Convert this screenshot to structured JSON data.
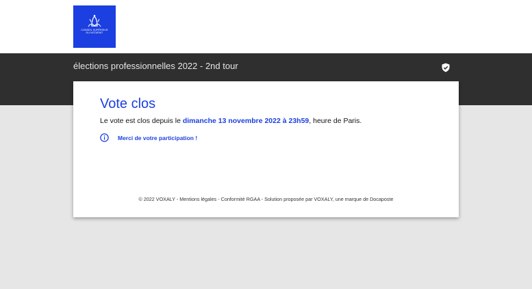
{
  "logo": {
    "line1": "CONSEIL SUPÉRIEUR",
    "line2": "DU NOTARIAT"
  },
  "header": {
    "title": "élections professionnelles 2022 - 2nd tour",
    "icon": "shield-check-icon"
  },
  "card": {
    "title": "Vote clos",
    "text_before": "Le vote est clos depuis le",
    "text_highlight": "dimanche 13 novembre 2022 à 23h59",
    "text_after": ", heure de Paris.",
    "info_icon": "info-icon",
    "info_text": "Merci de votre participation !"
  },
  "footer": {
    "copyright": "© 2022 VOXALY",
    "sep": " - ",
    "legal": "Mentions légales",
    "rgaa": "Conformité RGAA",
    "solution": "Solution proposée par VOXALY, une marque de Docaposte"
  },
  "colors": {
    "accent": "#1b3fe0",
    "band": "#2f2f2f",
    "background": "#e6e6e6"
  }
}
